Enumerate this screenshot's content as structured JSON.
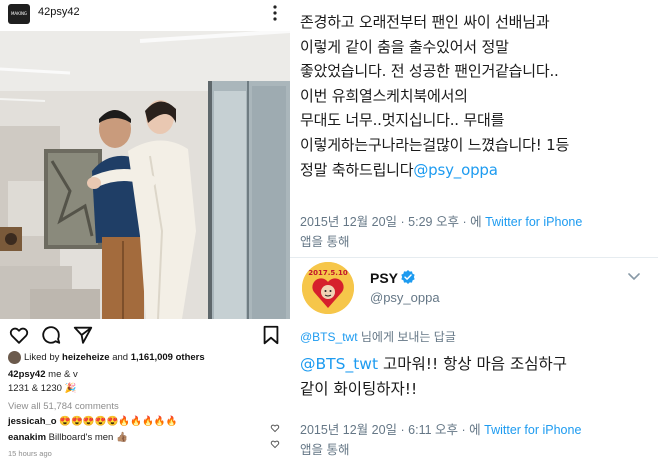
{
  "instagram": {
    "avatar_text": "MAKING NATION",
    "username": "42psy42",
    "more_icon": "more-vertical-icon",
    "actions": [
      "heart-icon",
      "comment-icon",
      "share-icon",
      "bookmark-icon"
    ],
    "likes": {
      "prefix": "Liked by ",
      "user": "heizeheize",
      "middle": " and ",
      "count": "1,161,009 others"
    },
    "caption": {
      "user": "42psy42",
      "text": " me & v"
    },
    "caption_line2": "1231 & 1230 🎉",
    "view_comments": "View all 51,784 comments",
    "comments": [
      {
        "user": "jessicah_o",
        "text": " 😍😍😍😍😍🔥🔥🔥🔥🔥"
      },
      {
        "user": "eanakim",
        "text": " Billboard's men 👍🏽"
      }
    ],
    "time_ago": "15 hours ago"
  },
  "twitter": {
    "tweet_lines": [
      "존경하고 오래전부터 팬인 싸이 선배님과",
      "이렇게 같이 춤을 출수있어서 정말",
      "좋았었습니다. 전 성공한 팬인거같습니다..",
      "이번 유희열스케치북에서의",
      "무대도 너무..멋지십니다.. 무대를",
      "이렇게하는구나라는걸많이 느꼈습니다! 1등"
    ],
    "tweet_last_prefix": "정말 축하드립니다",
    "tweet_mention": "@psy_oppa",
    "meta1": {
      "datetime": "2015년 12월 20일 · 5:29 오후 · 에 ",
      "client": "Twitter for iPhone",
      "suffix": "앱을 통해"
    },
    "reply_author": {
      "name": "PSY",
      "handle": "@psy_oppa",
      "avatar_text": "2017.5.10"
    },
    "reply_to": {
      "mention": "@BTS_twt",
      "text": " 님에게 보내는 답글"
    },
    "reply_mention": "@BTS_twt",
    "reply_line1_rest": " 고마워!! 항상 마음 조심하구",
    "reply_line2": "같이 화이팅하자!!",
    "meta2": {
      "datetime": "2015년 12월 20일 · 6:11 오후 · 에 ",
      "client": "Twitter for iPhone",
      "suffix": "앱을 통해"
    },
    "colors": {
      "link": "#1d9bf0",
      "meta": "#657786"
    }
  }
}
